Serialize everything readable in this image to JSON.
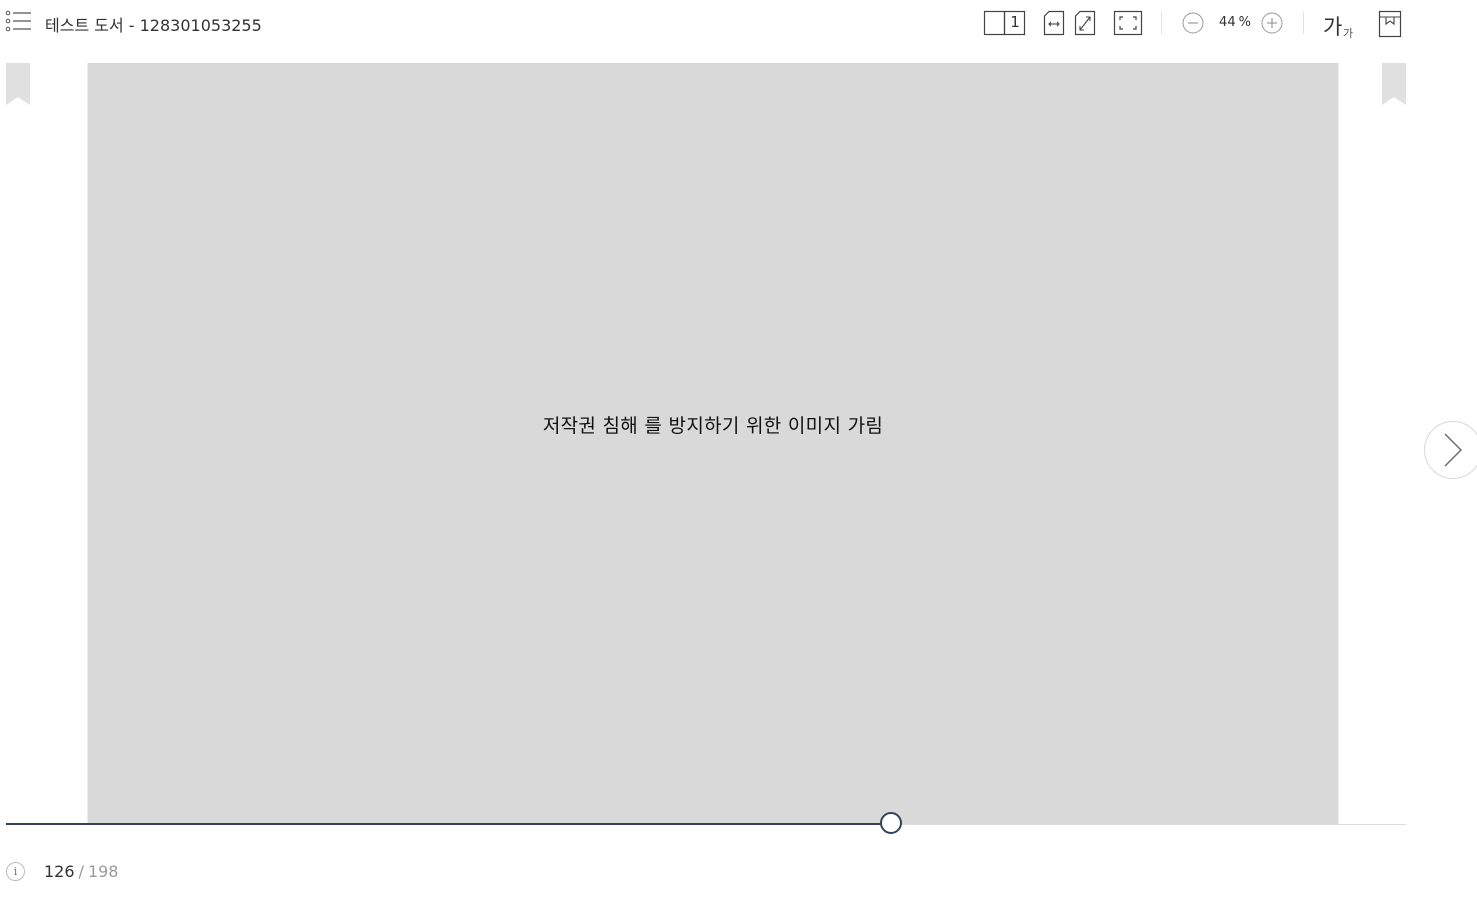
{
  "header": {
    "title": "테스트 도서 - 128301053255",
    "layout_toggle": {
      "page_count_label": "1"
    },
    "zoom": {
      "value": "44",
      "unit": "%"
    },
    "font_size": {
      "large_glyph": "가",
      "small_glyph": "가"
    }
  },
  "icons": {
    "toc": "list-icon",
    "page_layout": "single-page-layout-icon",
    "fit_width": "fit-width-icon",
    "fit_page": "fit-page-icon",
    "fullscreen": "fullscreen-icon",
    "zoom_out": "minus-circle-icon",
    "zoom_in": "plus-circle-icon",
    "bookmark": "bookmark-icon",
    "next_page": "chevron-right-icon",
    "info": "info-icon"
  },
  "content": {
    "mask_text": "저작권 침해 를 방지하기 위한 이미지 가림"
  },
  "footer": {
    "info_glyph": "i",
    "current_page": "126",
    "separator": "/",
    "total_pages": "198",
    "progress_fraction": 0.632
  },
  "colors": {
    "accent": "#33435f",
    "page_mask": "#d9d9d9",
    "ribbon": "#e0e0e0"
  }
}
